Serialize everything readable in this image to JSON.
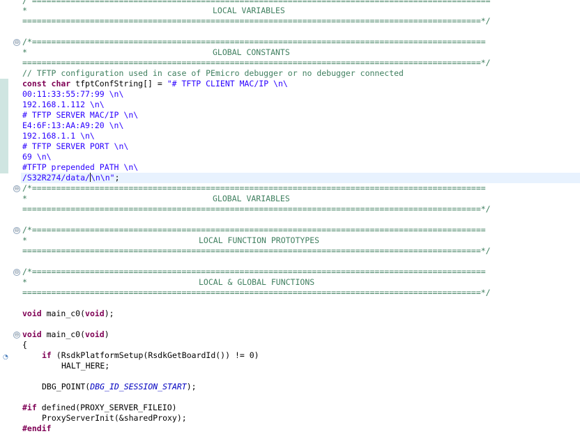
{
  "code": {
    "local_var_top": "/ ===============================================================================================",
    "local_var_title": "LOCAL VARIABLES",
    "sep_close": "===============================================================================================*/",
    "sep_open": "/*==============================================================================================",
    "star": "*",
    "global_constants_title": "GLOBAL CONSTANTS",
    "tftp_comment": "// TFTP configuration used in case of PEmicro debugger or no debugger connected",
    "const_kw": "const char",
    "decl_rest": " tfptConfString[] = ",
    "str1": "\"# TFTP CLIENT MAC/IP \\n\\",
    "str2": "00:11:33:55:77:99 \\n\\",
    "str3": "192.168.1.112 \\n\\",
    "str4": "# TFTP SERVER MAC/IP \\n\\",
    "str5": "E4:6F:13:AA:A9:20 \\n\\",
    "str6": "192.168.1.1 \\n\\",
    "str7": "# TFTP SERVER PORT \\n\\",
    "str8": "69 \\n\\",
    "str9": "#TFTP prepended PATH \\n\\",
    "str10_a": "/S32R274/data/",
    "str10_b": "\\n\\n\"",
    "str10_end": ";",
    "global_variables_title": "GLOBAL VARIABLES",
    "local_func_proto_title": "LOCAL FUNCTION PROTOTYPES",
    "local_global_func_title": "LOCAL & GLOBAL FUNCTIONS",
    "void_kw": "void",
    "proto_rest": " main_c0(",
    "proto_void": "void",
    "proto_end": ");",
    "def_rest": " main_c0(",
    "def_end": ")",
    "brace_open": "{",
    "if_kw": "if",
    "if_rest": " (RsdkPlatformSetup(RsdkGetBoardId()) != 0)",
    "halt": "HALT_HERE;",
    "dbg_a": "DBG_POINT(",
    "dbg_macro": "DBG_ID_SESSION_START",
    "dbg_b": ");",
    "if_directive": "#if",
    "if_directive_rest": " defined(PROXY_SERVER_FILEIO)",
    "proxy_init": "ProxyServerInit(&sharedProxy);",
    "endif_directive": "#endif"
  },
  "gutter": {
    "fold_glyph": "⊖",
    "marker_glyph": "◔"
  },
  "colors": {
    "comment": "#3f7f5f",
    "string": "#2a00ff",
    "keyword": "#7f0055",
    "macro": "#0000c0",
    "current_line": "#e8f2fe"
  }
}
